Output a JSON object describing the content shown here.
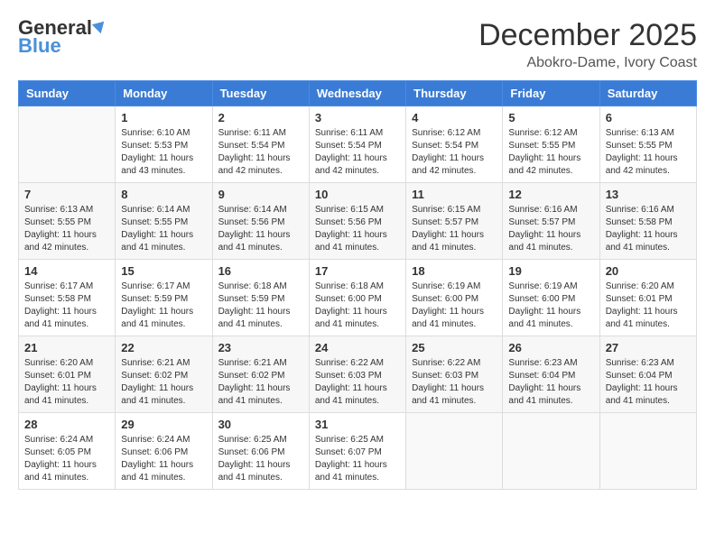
{
  "header": {
    "logo_general": "General",
    "logo_blue": "Blue",
    "month_title": "December 2025",
    "location": "Abokro-Dame, Ivory Coast"
  },
  "days_of_week": [
    "Sunday",
    "Monday",
    "Tuesday",
    "Wednesday",
    "Thursday",
    "Friday",
    "Saturday"
  ],
  "weeks": [
    [
      {
        "day": "",
        "empty": true
      },
      {
        "day": "1",
        "sunrise": "Sunrise: 6:10 AM",
        "sunset": "Sunset: 5:53 PM",
        "daylight": "Daylight: 11 hours and 43 minutes."
      },
      {
        "day": "2",
        "sunrise": "Sunrise: 6:11 AM",
        "sunset": "Sunset: 5:54 PM",
        "daylight": "Daylight: 11 hours and 42 minutes."
      },
      {
        "day": "3",
        "sunrise": "Sunrise: 6:11 AM",
        "sunset": "Sunset: 5:54 PM",
        "daylight": "Daylight: 11 hours and 42 minutes."
      },
      {
        "day": "4",
        "sunrise": "Sunrise: 6:12 AM",
        "sunset": "Sunset: 5:54 PM",
        "daylight": "Daylight: 11 hours and 42 minutes."
      },
      {
        "day": "5",
        "sunrise": "Sunrise: 6:12 AM",
        "sunset": "Sunset: 5:55 PM",
        "daylight": "Daylight: 11 hours and 42 minutes."
      },
      {
        "day": "6",
        "sunrise": "Sunrise: 6:13 AM",
        "sunset": "Sunset: 5:55 PM",
        "daylight": "Daylight: 11 hours and 42 minutes."
      }
    ],
    [
      {
        "day": "7",
        "sunrise": "Sunrise: 6:13 AM",
        "sunset": "Sunset: 5:55 PM",
        "daylight": "Daylight: 11 hours and 42 minutes."
      },
      {
        "day": "8",
        "sunrise": "Sunrise: 6:14 AM",
        "sunset": "Sunset: 5:55 PM",
        "daylight": "Daylight: 11 hours and 41 minutes."
      },
      {
        "day": "9",
        "sunrise": "Sunrise: 6:14 AM",
        "sunset": "Sunset: 5:56 PM",
        "daylight": "Daylight: 11 hours and 41 minutes."
      },
      {
        "day": "10",
        "sunrise": "Sunrise: 6:15 AM",
        "sunset": "Sunset: 5:56 PM",
        "daylight": "Daylight: 11 hours and 41 minutes."
      },
      {
        "day": "11",
        "sunrise": "Sunrise: 6:15 AM",
        "sunset": "Sunset: 5:57 PM",
        "daylight": "Daylight: 11 hours and 41 minutes."
      },
      {
        "day": "12",
        "sunrise": "Sunrise: 6:16 AM",
        "sunset": "Sunset: 5:57 PM",
        "daylight": "Daylight: 11 hours and 41 minutes."
      },
      {
        "day": "13",
        "sunrise": "Sunrise: 6:16 AM",
        "sunset": "Sunset: 5:58 PM",
        "daylight": "Daylight: 11 hours and 41 minutes."
      }
    ],
    [
      {
        "day": "14",
        "sunrise": "Sunrise: 6:17 AM",
        "sunset": "Sunset: 5:58 PM",
        "daylight": "Daylight: 11 hours and 41 minutes."
      },
      {
        "day": "15",
        "sunrise": "Sunrise: 6:17 AM",
        "sunset": "Sunset: 5:59 PM",
        "daylight": "Daylight: 11 hours and 41 minutes."
      },
      {
        "day": "16",
        "sunrise": "Sunrise: 6:18 AM",
        "sunset": "Sunset: 5:59 PM",
        "daylight": "Daylight: 11 hours and 41 minutes."
      },
      {
        "day": "17",
        "sunrise": "Sunrise: 6:18 AM",
        "sunset": "Sunset: 6:00 PM",
        "daylight": "Daylight: 11 hours and 41 minutes."
      },
      {
        "day": "18",
        "sunrise": "Sunrise: 6:19 AM",
        "sunset": "Sunset: 6:00 PM",
        "daylight": "Daylight: 11 hours and 41 minutes."
      },
      {
        "day": "19",
        "sunrise": "Sunrise: 6:19 AM",
        "sunset": "Sunset: 6:00 PM",
        "daylight": "Daylight: 11 hours and 41 minutes."
      },
      {
        "day": "20",
        "sunrise": "Sunrise: 6:20 AM",
        "sunset": "Sunset: 6:01 PM",
        "daylight": "Daylight: 11 hours and 41 minutes."
      }
    ],
    [
      {
        "day": "21",
        "sunrise": "Sunrise: 6:20 AM",
        "sunset": "Sunset: 6:01 PM",
        "daylight": "Daylight: 11 hours and 41 minutes."
      },
      {
        "day": "22",
        "sunrise": "Sunrise: 6:21 AM",
        "sunset": "Sunset: 6:02 PM",
        "daylight": "Daylight: 11 hours and 41 minutes."
      },
      {
        "day": "23",
        "sunrise": "Sunrise: 6:21 AM",
        "sunset": "Sunset: 6:02 PM",
        "daylight": "Daylight: 11 hours and 41 minutes."
      },
      {
        "day": "24",
        "sunrise": "Sunrise: 6:22 AM",
        "sunset": "Sunset: 6:03 PM",
        "daylight": "Daylight: 11 hours and 41 minutes."
      },
      {
        "day": "25",
        "sunrise": "Sunrise: 6:22 AM",
        "sunset": "Sunset: 6:03 PM",
        "daylight": "Daylight: 11 hours and 41 minutes."
      },
      {
        "day": "26",
        "sunrise": "Sunrise: 6:23 AM",
        "sunset": "Sunset: 6:04 PM",
        "daylight": "Daylight: 11 hours and 41 minutes."
      },
      {
        "day": "27",
        "sunrise": "Sunrise: 6:23 AM",
        "sunset": "Sunset: 6:04 PM",
        "daylight": "Daylight: 11 hours and 41 minutes."
      }
    ],
    [
      {
        "day": "28",
        "sunrise": "Sunrise: 6:24 AM",
        "sunset": "Sunset: 6:05 PM",
        "daylight": "Daylight: 11 hours and 41 minutes."
      },
      {
        "day": "29",
        "sunrise": "Sunrise: 6:24 AM",
        "sunset": "Sunset: 6:06 PM",
        "daylight": "Daylight: 11 hours and 41 minutes."
      },
      {
        "day": "30",
        "sunrise": "Sunrise: 6:25 AM",
        "sunset": "Sunset: 6:06 PM",
        "daylight": "Daylight: 11 hours and 41 minutes."
      },
      {
        "day": "31",
        "sunrise": "Sunrise: 6:25 AM",
        "sunset": "Sunset: 6:07 PM",
        "daylight": "Daylight: 11 hours and 41 minutes."
      },
      {
        "day": "",
        "empty": true
      },
      {
        "day": "",
        "empty": true
      },
      {
        "day": "",
        "empty": true
      }
    ]
  ]
}
